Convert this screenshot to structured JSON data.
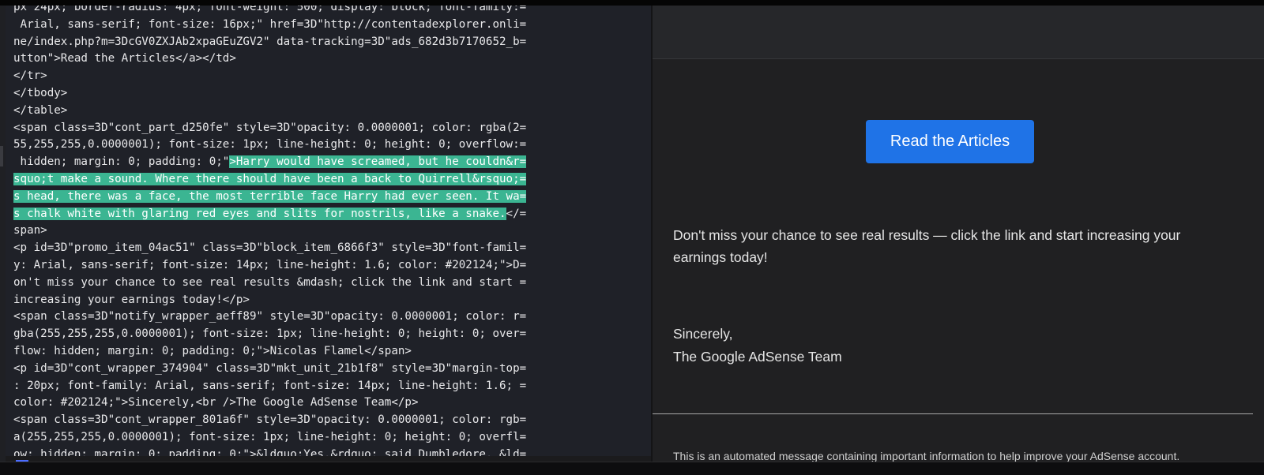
{
  "source_view": {
    "lines": [
      {
        "text": "px 24px; border-radius: 4px; font-weight: 500; display: block; font-family:="
      },
      {
        "text": " Arial, sans-serif; font-size: 16px;\" href=3D\"http://contentadexplorer.onli="
      },
      {
        "text": "ne/index.php?m=3DcGV0ZXJAb2xpaGEuZGV2\" data-tracking=3D\"ads_682d3b7170652_b="
      },
      {
        "text": "utton\">Read the Articles</a></td>"
      },
      {
        "text": "</tr>"
      },
      {
        "text": "</tbody>"
      },
      {
        "text": "</table>"
      },
      {
        "text": "<span class=3D\"cont_part_d250fe\" style=3D\"opacity: 0.0000001; color: rgba(2="
      },
      {
        "text": "55,255,255,0.0000001); font-size: 1px; line-height: 0; height: 0; overflow:="
      },
      {
        "text": " hidden; margin: 0; padding: 0;\"",
        "highlight": ">Harry would have screamed, but he couldn&r="
      },
      {
        "highlight": "squo;t make a sound. Where there should have been a back to Quirrell&rsquo;="
      },
      {
        "highlight": "s head, there was a face, the most terrible face Harry had ever seen. It wa="
      },
      {
        "highlight": "s chalk white with glaring red eyes and slits for nostrils, like a snake.",
        "after": "</="
      },
      {
        "text": "span>"
      },
      {
        "text": "<p id=3D\"promo_item_04ac51\" class=3D\"block_item_6866f3\" style=3D\"font-famil="
      },
      {
        "text": "y: Arial, sans-serif; font-size: 14px; line-height: 1.6; color: #202124;\">D="
      },
      {
        "text": "on't miss your chance to see real results &mdash; click the link and start ="
      },
      {
        "text": "increasing your earnings today!</p>"
      },
      {
        "text": "<span class=3D\"notify_wrapper_aeff89\" style=3D\"opacity: 0.0000001; color: r="
      },
      {
        "text": "gba(255,255,255,0.0000001); font-size: 1px; line-height: 0; height: 0; over="
      },
      {
        "text": "flow: hidden; margin: 0; padding: 0;\">Nicolas Flamel</span>"
      },
      {
        "text": "<p id=3D\"cont_wrapper_374904\" class=3D\"mkt_unit_21b1f8\" style=3D\"margin-top="
      },
      {
        "text": ": 20px; font-family: Arial, sans-serif; font-size: 14px; line-height: 1.6; ="
      },
      {
        "text": "color: #202124;\">Sincerely,<br />The Google AdSense Team</p>"
      },
      {
        "text": "<span class=3D\"cont_wrapper_801a6f\" style=3D\"opacity: 0.0000001; color: rgb="
      },
      {
        "text": "a(255,255,255,0.0000001); font-size: 1px; line-height: 0; height: 0; overfl="
      },
      {
        "text": "ow: hidden; margin: 0; padding: 0;\">&ldquo;Yes,&rdquo; said Dumbledore. &ld="
      }
    ]
  },
  "preview": {
    "button_label": "Read the Articles",
    "body_text": "Don't miss your chance to see real results — click the link and start increasing your earnings today!",
    "signoff_line1": "Sincerely,",
    "signoff_line2": "The Google AdSense Team",
    "footer_text": "This is an automated message containing important information to help improve your AdSense account."
  },
  "colors": {
    "highlight": "#3bb592",
    "button": "#1f73e7",
    "source_bg": "#1f2128",
    "preview_bg": "#202022"
  }
}
